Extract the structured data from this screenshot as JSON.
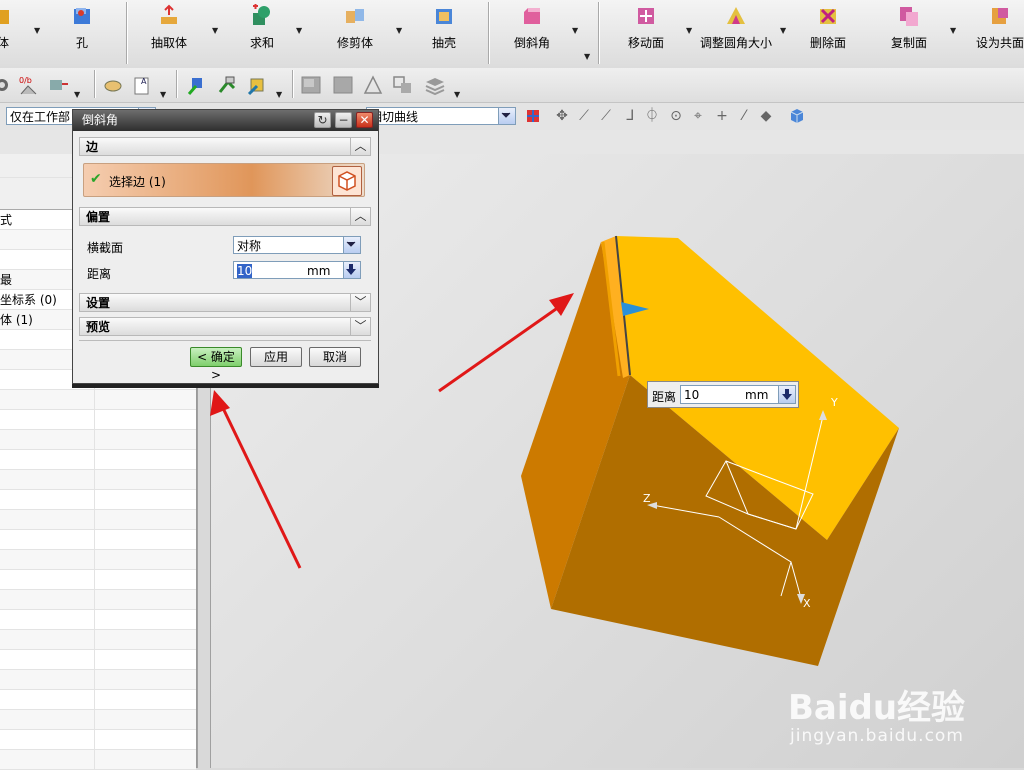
{
  "ribbon": {
    "items": [
      {
        "label": "体"
      },
      {
        "label": "孔"
      },
      {
        "label": "抽取体"
      },
      {
        "label": "求和"
      },
      {
        "label": "修剪体"
      },
      {
        "label": "抽壳"
      },
      {
        "label": "倒斜角"
      },
      {
        "label": "移动面"
      },
      {
        "label": "调整圆角大小"
      },
      {
        "label": "删除面"
      },
      {
        "label": "复制面"
      },
      {
        "label": "设为共面"
      }
    ]
  },
  "selection_bar": {
    "filter_value": "仅在工作部",
    "curve_rule_value": "相切曲线"
  },
  "left_panel": {
    "rows": [
      "式",
      "",
      "",
      "最",
      "坐标系 (0)",
      "体 (1)"
    ]
  },
  "dialog": {
    "title": "倒斜角",
    "edge_section": "边",
    "select_edge_label": "选择边 (1)",
    "offset_section": "偏置",
    "cross_section_label": "横截面",
    "cross_section_value": "对称",
    "distance_label": "距离",
    "distance_value": "10",
    "distance_unit": "mm",
    "settings_section": "设置",
    "preview_section": "预览",
    "ok_button": "< 确定 >",
    "apply_button": "应用",
    "cancel_button": "取消"
  },
  "viewport": {
    "onscreen_distance_label": "距离",
    "onscreen_distance_value": "10",
    "onscreen_distance_unit": "mm",
    "axis_x": "X",
    "axis_y": "Y",
    "axis_z": "Z",
    "part_color": "#f0a000"
  },
  "watermark": {
    "brand": "Baidu经验",
    "url": "jingyan.baidu.com"
  }
}
